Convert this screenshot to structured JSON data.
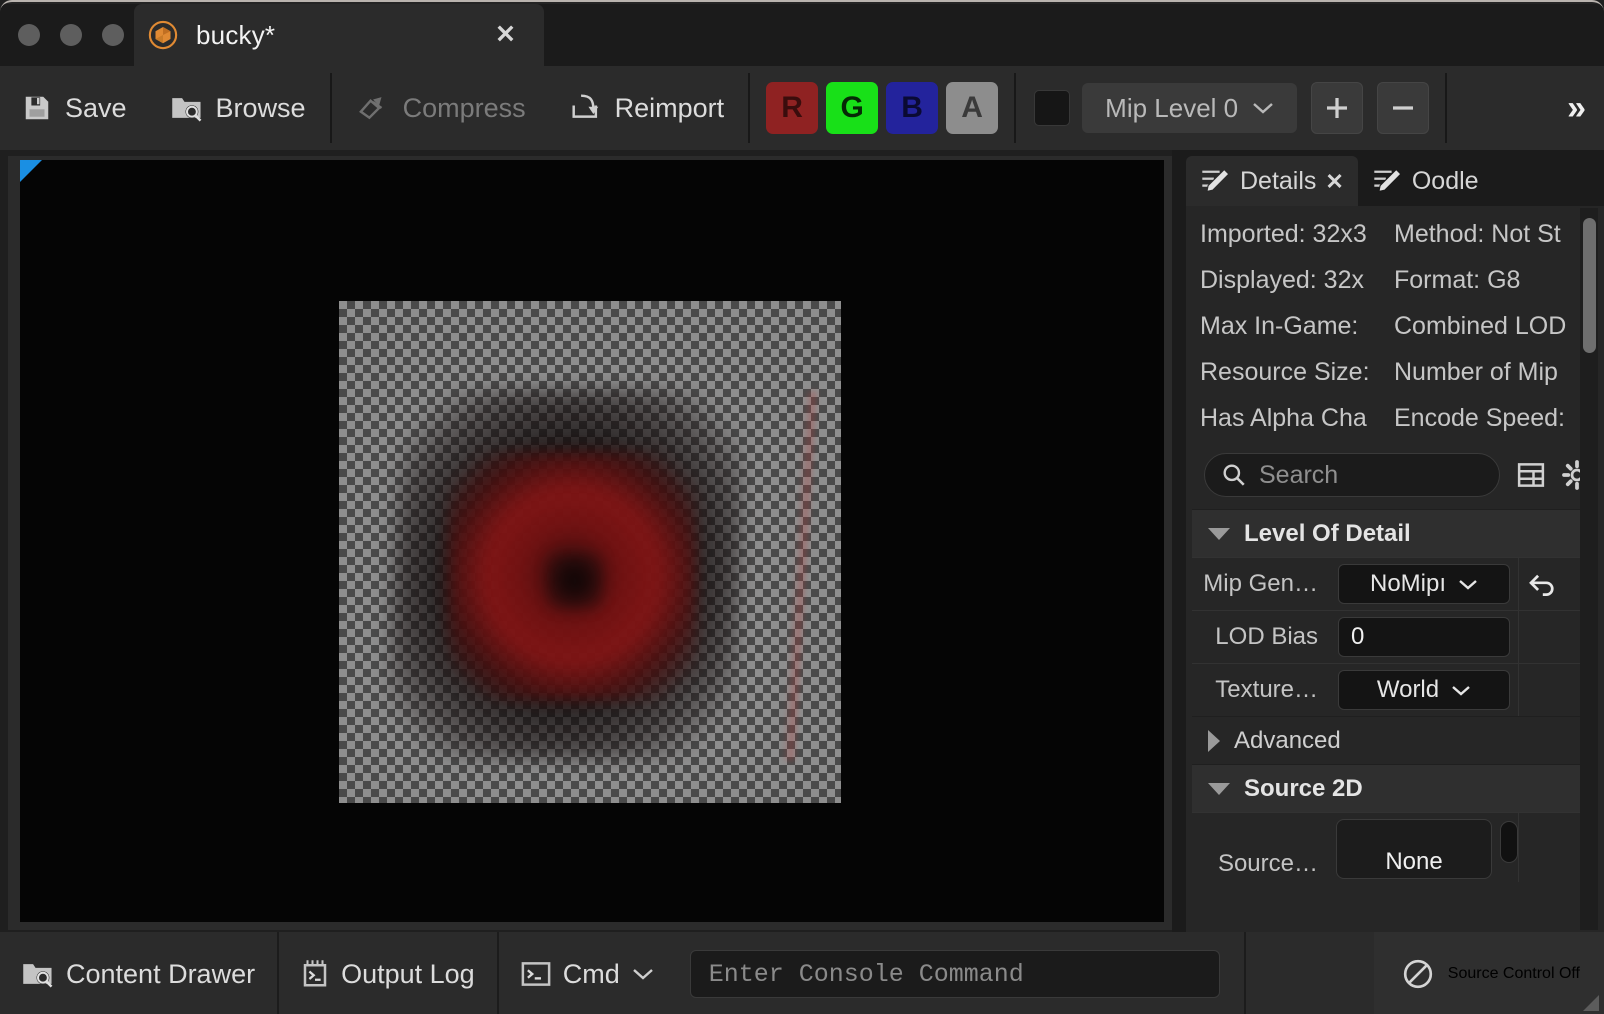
{
  "window": {
    "traffic_lights": [
      "close",
      "minimize",
      "zoom"
    ],
    "tab": {
      "icon": "unreal-asset-cube-icon",
      "title": "bucky*",
      "close_label": "✕"
    }
  },
  "toolbar": {
    "save_label": "Save",
    "browse_label": "Browse",
    "compress_label": "Compress",
    "compress_disabled": true,
    "reimport_label": "Reimport",
    "channels": [
      {
        "key": "R",
        "label": "R",
        "state": "off",
        "color": "#8f2222"
      },
      {
        "key": "G",
        "label": "G",
        "state": "on",
        "color": "#18e018"
      },
      {
        "key": "B",
        "label": "B",
        "state": "off",
        "color": "#23239c"
      },
      {
        "key": "A",
        "label": "A",
        "state": "off",
        "color": "#8d8d8d"
      }
    ],
    "mip_checkbox_checked": false,
    "mip_level_label": "Mip Level 0",
    "plus_label": "+",
    "minus_label": "−",
    "overflow_label": "»"
  },
  "viewport": {
    "corner_marker": "blue-corner-marker",
    "texture_background": "checkerboard-transparency",
    "texture_description": "blurred dark red circular shape"
  },
  "details": {
    "tabs": [
      {
        "label": "Details",
        "icon": "details-pencil-icon",
        "active": true,
        "closable": true,
        "close_label": "✕"
      },
      {
        "label": "Oodle",
        "icon": "oodle-pencil-icon",
        "active": false,
        "closable": false
      }
    ],
    "info": [
      "Imported: 32x3",
      "Method: Not St",
      "Displayed: 32x",
      "Format: G8",
      "Max In-Game:",
      "Combined LOD",
      "Resource Size:",
      "Number of Mip",
      "Has Alpha Cha",
      "Encode Speed:"
    ],
    "search": {
      "placeholder": "Search",
      "value": ""
    },
    "toolbar_icons": [
      "columns-icon",
      "gear-icon"
    ],
    "sections": [
      {
        "name": "Level Of Detail",
        "expanded": true,
        "rows": [
          {
            "label": "Mip Gen…",
            "type": "combo",
            "value": "NoMipı",
            "has_reset": true,
            "reset_icon": "reset-arrow-icon"
          },
          {
            "label": "LOD Bias",
            "type": "input",
            "value": "0",
            "has_reset": false
          },
          {
            "label": "Texture…",
            "type": "combo",
            "value": "World",
            "has_reset": false
          }
        ]
      },
      {
        "name": "Advanced",
        "expanded": false,
        "rows": []
      },
      {
        "name": "Source 2D",
        "expanded": true,
        "rows": [
          {
            "label": "Source…",
            "type": "asset",
            "value": "None",
            "has_reset": false
          }
        ]
      }
    ]
  },
  "statusbar": {
    "content_drawer_label": "Content Drawer",
    "output_log_label": "Output Log",
    "cmd_label": "Cmd",
    "console_placeholder": "Enter Console Command",
    "console_value": "",
    "source_control_label": "Source Control Off",
    "source_control_icon": "no-entry-icon"
  }
}
